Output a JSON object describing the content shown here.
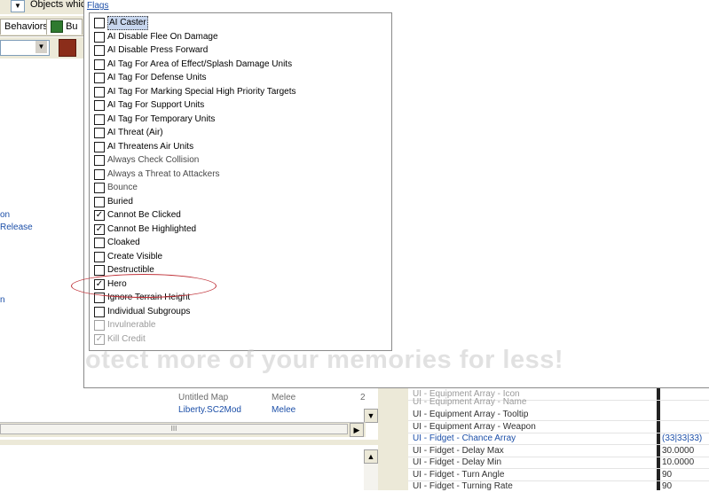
{
  "toolbar": {
    "objects_label": "Objects whic",
    "tabs": [
      {
        "label": "Behaviors"
      },
      {
        "label": "Bu"
      }
    ]
  },
  "tree": {
    "links": [
      "on",
      "Release",
      "n"
    ]
  },
  "bottom_list": {
    "rows": [
      {
        "name": "Untitled Map",
        "type": "Melee",
        "extra": "2"
      },
      {
        "name": "Liberty.SC2Mod",
        "type": "Melee",
        "extra": "-"
      }
    ],
    "scroll_thumb_label": "III"
  },
  "flags_popup": {
    "title": "Flags",
    "items": [
      {
        "label": "AI Caster",
        "checked": false,
        "selected": true,
        "state": "normal"
      },
      {
        "label": "AI Disable Flee On Damage",
        "checked": false,
        "state": "normal"
      },
      {
        "label": "AI Disable Press Forward",
        "checked": false,
        "state": "normal"
      },
      {
        "label": "AI Tag For Area of Effect/Splash Damage Units",
        "checked": false,
        "state": "normal"
      },
      {
        "label": "AI Tag For Defense Units",
        "checked": false,
        "state": "normal"
      },
      {
        "label": "AI Tag For Marking Special High Priority Targets",
        "checked": false,
        "state": "normal"
      },
      {
        "label": "AI Tag For Support Units",
        "checked": false,
        "state": "normal"
      },
      {
        "label": "AI Tag For Temporary Units",
        "checked": false,
        "state": "normal"
      },
      {
        "label": "AI Threat (Air)",
        "checked": false,
        "state": "normal"
      },
      {
        "label": "AI Threatens Air Units",
        "checked": false,
        "state": "normal"
      },
      {
        "label": "Always Check Collision",
        "checked": false,
        "state": "faded"
      },
      {
        "label": "Always a Threat to Attackers",
        "checked": false,
        "state": "faded"
      },
      {
        "label": "Bounce",
        "checked": false,
        "state": "faded"
      },
      {
        "label": "Buried",
        "checked": false,
        "state": "normal"
      },
      {
        "label": "Cannot Be Clicked",
        "checked": true,
        "state": "normal"
      },
      {
        "label": "Cannot Be Highlighted",
        "checked": true,
        "state": "normal"
      },
      {
        "label": "Cloaked",
        "checked": false,
        "state": "normal"
      },
      {
        "label": "Create Visible",
        "checked": false,
        "state": "normal"
      },
      {
        "label": "Destructible",
        "checked": false,
        "state": "normal"
      },
      {
        "label": "Hero",
        "checked": true,
        "state": "normal",
        "circled": true
      },
      {
        "label": "Ignore Terrain Height",
        "checked": false,
        "state": "normal"
      },
      {
        "label": "Individual Subgroups",
        "checked": false,
        "state": "normal"
      },
      {
        "label": "Invulnerable",
        "checked": false,
        "state": "disabled"
      },
      {
        "label": "Kill Credit",
        "checked": true,
        "state": "disabled"
      }
    ],
    "annotation_color": "#c0333a"
  },
  "watermark": "otect more of your memories for less!",
  "property_grid": {
    "rows": [
      {
        "name": "UI - Equipment Array - Icon",
        "value": "",
        "style": "muted"
      },
      {
        "name": "UI - Equipment Array - Name",
        "value": "",
        "style": "muted"
      },
      {
        "name": "UI - Equipment Array - Tooltip",
        "value": "",
        "style": "normal"
      },
      {
        "name": "UI - Equipment Array - Weapon",
        "value": "",
        "style": "normal"
      },
      {
        "name": "UI - Fidget - Chance Array",
        "value": "(33|33|33)",
        "style": "hl"
      },
      {
        "name": "UI - Fidget - Delay Max",
        "value": "30.0000",
        "style": "normal"
      },
      {
        "name": "UI - Fidget - Delay Min",
        "value": "10.0000",
        "style": "normal"
      },
      {
        "name": "UI - Fidget - Turn Angle",
        "value": "90",
        "style": "normal"
      },
      {
        "name": "UI - Fidget - Turning Rate",
        "value": "90",
        "style": "normal"
      }
    ]
  },
  "colors": {
    "link": "#1c4fa8",
    "selection": "#c7d6ee",
    "chrome": "#ece9d8"
  }
}
